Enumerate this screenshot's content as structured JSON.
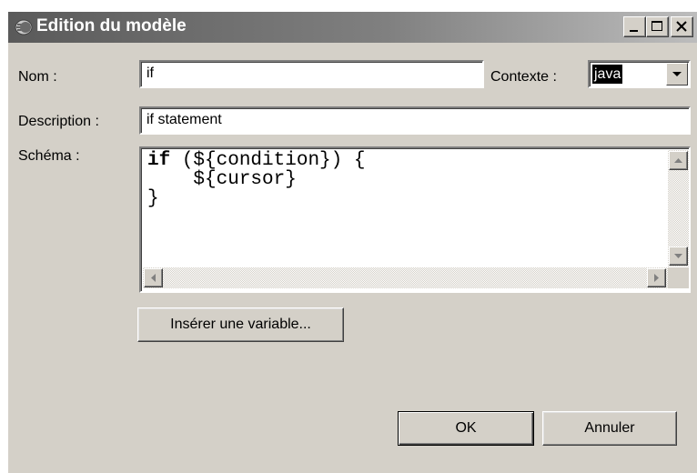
{
  "window": {
    "title": "Edition du modèle"
  },
  "form": {
    "name_label": "Nom :",
    "name_value": "if",
    "context_label": "Contexte :",
    "context_value": "java",
    "description_label": "Description :",
    "description_value": "if statement",
    "pattern_label": "Schéma :",
    "pattern_lines": [
      "if (${condition}) {",
      "    ${cursor}",
      "}"
    ]
  },
  "buttons": {
    "insert_variable": "Insérer une variable...",
    "ok": "OK",
    "cancel": "Annuler"
  },
  "icons": [
    "app-icon",
    "minimize-icon",
    "maximize-icon",
    "close-icon",
    "chevron-down-icon",
    "arrow-up-icon",
    "arrow-down-icon",
    "arrow-left-icon",
    "arrow-right-icon"
  ]
}
